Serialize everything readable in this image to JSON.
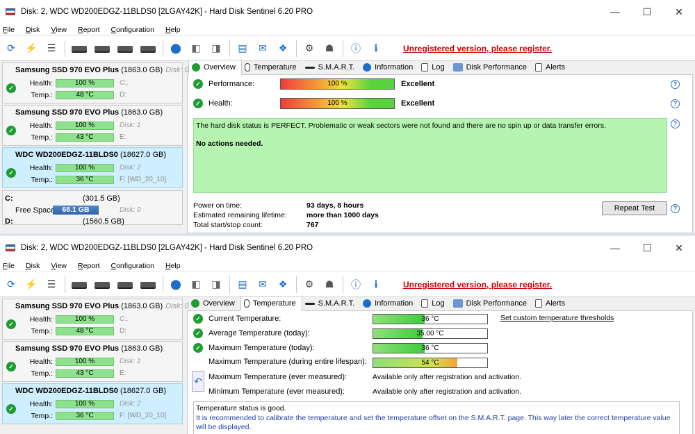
{
  "window": {
    "title": "Disk: 2, WDC WD200EDGZ-11BLDS0 [2LGAY42K]  -  Hard Disk Sentinel 6.20 PRO",
    "minimize": "—",
    "maximize": "☐",
    "close": "✕"
  },
  "menu": [
    "File",
    "Disk",
    "View",
    "Report",
    "Configuration",
    "Help"
  ],
  "toolbar": {
    "register_text": "Unregistered version, please register."
  },
  "disks": [
    {
      "name": "Samsung SSD 970 EVO Plus",
      "size": "(1863.0 GB)",
      "disk": "Disk: 0",
      "health_label": "Health:",
      "health": "100 %",
      "health_sub": "C:,",
      "temp_label": "Temp.:",
      "temp": "48 °C",
      "temp_sub": "D:"
    },
    {
      "name": "Samsung SSD 970 EVO Plus",
      "size": "(1863.0 GB)",
      "disk": "Disk: 1",
      "health_label": "Health:",
      "health": "100 %",
      "health_sub": "Disk: 1",
      "temp_label": "Temp.:",
      "temp": "43 °C",
      "temp_sub": "E:"
    },
    {
      "name": "WDC WD200EDGZ-11BLDS0",
      "size": "(18627.0 GB)",
      "disk": "",
      "health_label": "Health:",
      "health": "100 %",
      "health_sub": "Disk: 2",
      "temp_label": "Temp.:",
      "temp": "36 °C",
      "temp_sub": "F: [WD_20_10]"
    }
  ],
  "partitions": {
    "c_label": "C:",
    "c_size": "(301.5 GB)",
    "free_label": "Free Space",
    "free_value": "68.1 GB",
    "free_disk": "Disk: 0",
    "d_label": "D:",
    "d_size": "(1560.5 GB)"
  },
  "tabs": {
    "overview": "Overview",
    "temperature": "Temperature",
    "smart": "S.M.A.R.T.",
    "information": "Information",
    "log": "Log",
    "performance": "Disk Performance",
    "alerts": "Alerts"
  },
  "overview": {
    "performance_label": "Performance:",
    "performance_value": "100 %",
    "performance_text": "Excellent",
    "health_label": "Health:",
    "health_value": "100 %",
    "health_text": "Excellent",
    "status_text": "The hard disk status is PERFECT. Problematic or weak sectors were not found and there are no spin up or data transfer errors.",
    "actions_text": "No actions needed.",
    "power_on_label": "Power on time:",
    "power_on_value": "93 days, 8 hours",
    "lifetime_label": "Estimated remaining lifetime:",
    "lifetime_value": "more than 1000 days",
    "startstop_label": "Total start/stop count:",
    "startstop_value": "767",
    "repeat_button": "Repeat Test",
    "help": "?"
  },
  "temperature": {
    "current_label": "Current Temperature:",
    "current_value": "36 °C",
    "current_fill": 0.45,
    "avg_label": "Average Temperature (today):",
    "avg_value": "35.00 °C",
    "avg_fill": 0.43,
    "max_today_label": "Maximum Temperature (today):",
    "max_today_value": "36 °C",
    "max_today_fill": 0.45,
    "max_life_label": "Maximum Temperature (during entire lifespan):",
    "max_life_value": "54 °C",
    "max_life_fill": 0.74,
    "max_ever_label": "Maximum Temperature (ever measured):",
    "max_ever_value": "Available only after registration and activation.",
    "min_ever_label": "Minimum Temperature (ever measured):",
    "min_ever_value": "Available only after registration and activation.",
    "thresholds_link": "Set custom temperature thresholds",
    "status_text": "Temperature status is good.",
    "advice_text": "It is recommended to calibrate the temperature and set the temperature offset on the S.M.A.R.T. page. This way later the correct temperature value will be displayed."
  },
  "colors": {
    "accent": "#1c6fc9",
    "register": "#cc0000",
    "ok": "#1e9c31",
    "status_bg": "#b6f5b1"
  }
}
